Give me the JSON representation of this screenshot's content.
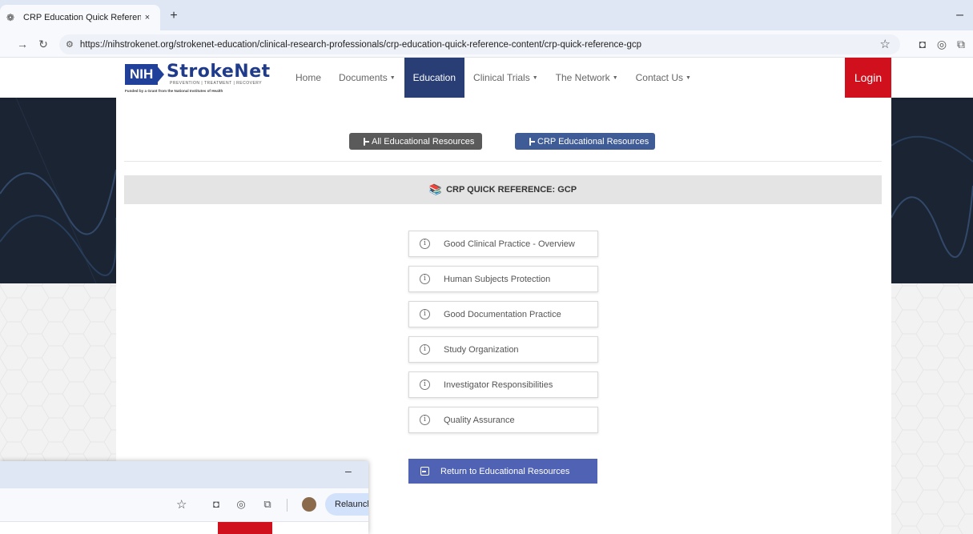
{
  "browser": {
    "tab_title": "CRP Education Quick Reference",
    "tab_close": "×",
    "new_tab": "+",
    "minimize": "–",
    "url": "https://nihstrokenet.org/strokenet-education/clinical-research-professionals/crp-education-quick-reference-content/crp-quick-reference-gcp"
  },
  "header": {
    "logo": {
      "nih": "NIH",
      "name": "StrokeNet",
      "tagline": "PREVENTION | TREATMENT | RECOVERY",
      "funded": "Funded by a Grant from the National Institutes of Health"
    },
    "nav": [
      {
        "label": "Home"
      },
      {
        "label": "Documents"
      },
      {
        "label": "Education"
      },
      {
        "label": "Clinical Trials"
      },
      {
        "label": "The Network"
      },
      {
        "label": "Contact Us"
      }
    ],
    "login_label": "Login"
  },
  "content": {
    "all_resources_label": "All Educational Resources",
    "crp_resources_label": "CRP Educational Resources",
    "section_title": "CRP QUICK REFERENCE: GCP",
    "items": [
      {
        "label": "Good Clinical Practice - Overview"
      },
      {
        "label": "Human Subjects Protection"
      },
      {
        "label": "Good Documentation Practice"
      },
      {
        "label": "Study Organization"
      },
      {
        "label": "Investigator Responsibilities"
      },
      {
        "label": "Quality Assurance"
      }
    ],
    "return_label": "Return to Educational Resources"
  },
  "second_window": {
    "minimize": "–",
    "relaunch_label": "Relaunch"
  },
  "colors": {
    "nav_active": "#283e74",
    "login": "#d0101d",
    "crp_button": "#3f5c96",
    "all_button": "#5a5a5a",
    "return_button": "#5062b4"
  }
}
